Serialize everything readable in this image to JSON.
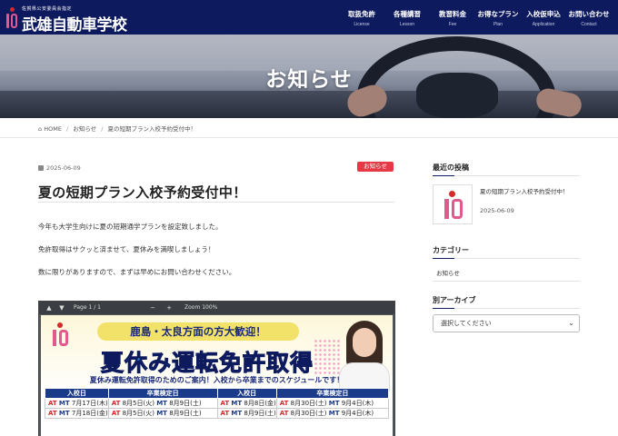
{
  "header": {
    "logo_sub": "佐賀県公安委員会指定",
    "logo_title": "武雄自動車学校",
    "nav": [
      {
        "jp": "取扱免許",
        "en": "License"
      },
      {
        "jp": "各種講習",
        "en": "Lesson"
      },
      {
        "jp": "教習料金",
        "en": "Fee"
      },
      {
        "jp": "お得なプラン",
        "en": "Plan"
      },
      {
        "jp": "入校仮申込",
        "en": "Application"
      },
      {
        "jp": "お問い合わせ",
        "en": "Contact"
      }
    ]
  },
  "hero": {
    "title": "お知らせ"
  },
  "breadcrumb": {
    "home": "HOME",
    "section": "お知らせ",
    "current": "夏の短期プラン入校予約受付中！"
  },
  "post": {
    "date": "2025-06-09",
    "category": "お知らせ",
    "title": "夏の短期プラン入校予約受付中！",
    "paragraphs": [
      "今年も大学生向けに夏の短期通学プランを設定致しました。",
      "免許取得はサクッと済ませて、夏休みを満喫しましょう！",
      "数に限りがありますので、まずは早めにお問い合わせください。"
    ]
  },
  "pdf_viewer": {
    "page_label": "Page",
    "page_current": "1",
    "page_sep": "/",
    "page_total": "1",
    "zoom_label": "Zoom 100%",
    "flyer": {
      "headline": "鹿島・太良方面の方大歓迎！",
      "big": "夏休み運転免許取得",
      "sub": "夏休み運転免許取得のためのご案内！入校から卒業までのスケジュールです！",
      "headers": [
        "入校日",
        "卒業検定日",
        "入校日",
        "卒業検定日"
      ],
      "rows": [
        [
          {
            "at": "AT",
            "mt": "MT",
            "text": "7月17日(木)"
          },
          {
            "at": "AT",
            "text1": "8月5日(火)",
            "mt": "MT",
            "text2": "8月9日(土)"
          },
          {
            "at": "AT",
            "mt": "MT",
            "text": "8月8日(金)"
          },
          {
            "at": "AT",
            "text1": "8月30日(土)",
            "mt": "MT",
            "text2": "9月4日(木)"
          }
        ],
        [
          {
            "at": "AT",
            "mt": "MT",
            "text": "7月18日(金)"
          },
          {
            "at": "AT",
            "text1": "8月5日(火)",
            "mt": "MT",
            "text2": "8月9日(土)"
          },
          {
            "at": "AT",
            "mt": "MT",
            "text": "8月9日(土)"
          },
          {
            "at": "AT",
            "text1": "8月30日(土)",
            "mt": "MT",
            "text2": "9月4日(木)"
          }
        ]
      ]
    }
  },
  "sidebar": {
    "recent_heading": "最近の投稿",
    "recent_title": "夏の短期プラン入校予約受付中！",
    "recent_date": "2025-06-09",
    "category_heading": "カテゴリー",
    "category_item": "お知らせ",
    "archive_heading": "別アーカイブ",
    "archive_placeholder": "選択してください"
  },
  "colors": {
    "header_bg": "#0e1a5e",
    "badge": "#e63946",
    "table_header": "#1a3a8a"
  }
}
